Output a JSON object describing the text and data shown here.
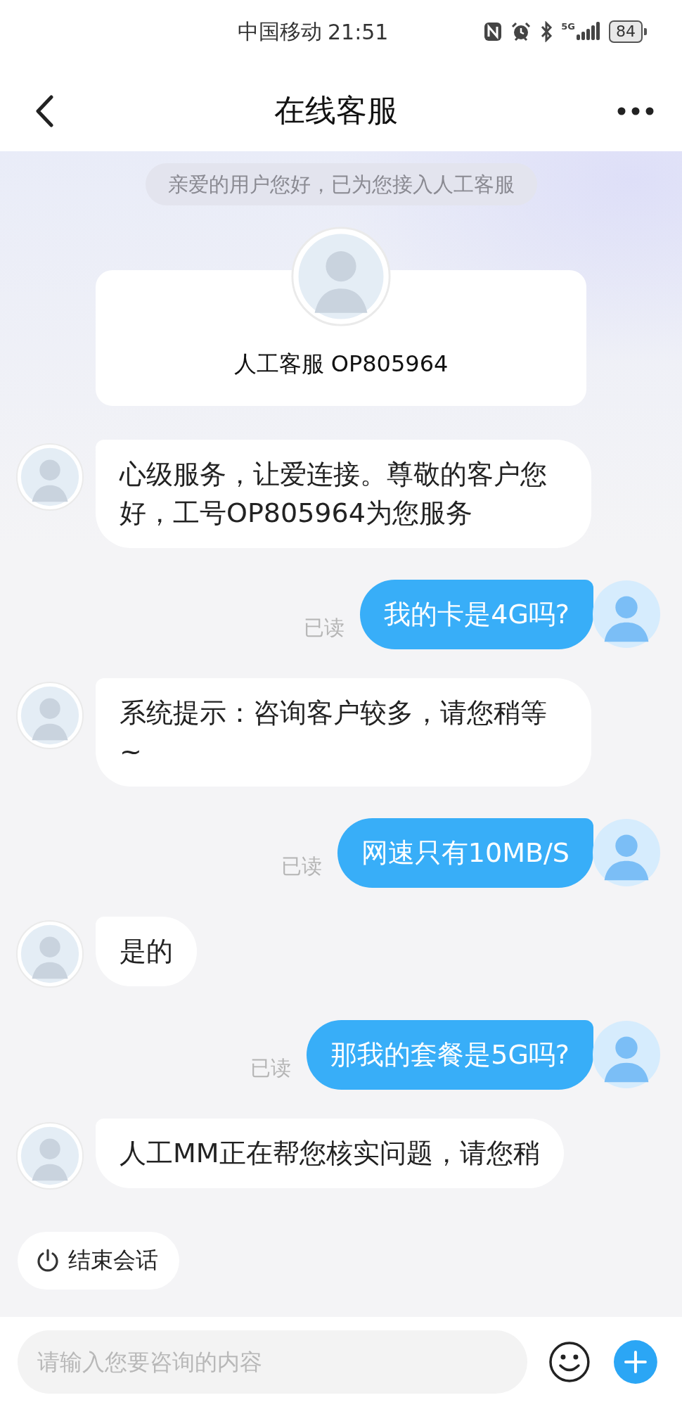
{
  "status_bar": {
    "carrier": "中国移动",
    "time": "21:51",
    "network": "5G",
    "battery": "84"
  },
  "header": {
    "title": "在线客服"
  },
  "notice": "亲爱的用户您好，已为您接入人工客服",
  "agent_card": {
    "name": "人工客服 OP805964"
  },
  "messages": [
    {
      "kind": "agent",
      "text": "心级服务，让爱连接。尊敬的客户您好，工号OP805964为您服务"
    },
    {
      "kind": "user",
      "text": "我的卡是4G吗?",
      "receipt": "已读"
    },
    {
      "kind": "agent",
      "text": "系统提示：咨询客户较多，请您稍等~"
    },
    {
      "kind": "user",
      "text": "网速只有10MB/S",
      "receipt": "已读"
    },
    {
      "kind": "agent",
      "text": "是的"
    },
    {
      "kind": "user",
      "text": "那我的套餐是5G吗?",
      "receipt": "已读"
    },
    {
      "kind": "agent",
      "text": "人工MM正在帮您核实问题，请您稍"
    }
  ],
  "end_button": "结束会话",
  "composer": {
    "placeholder": "请输入您要咨询的内容"
  }
}
